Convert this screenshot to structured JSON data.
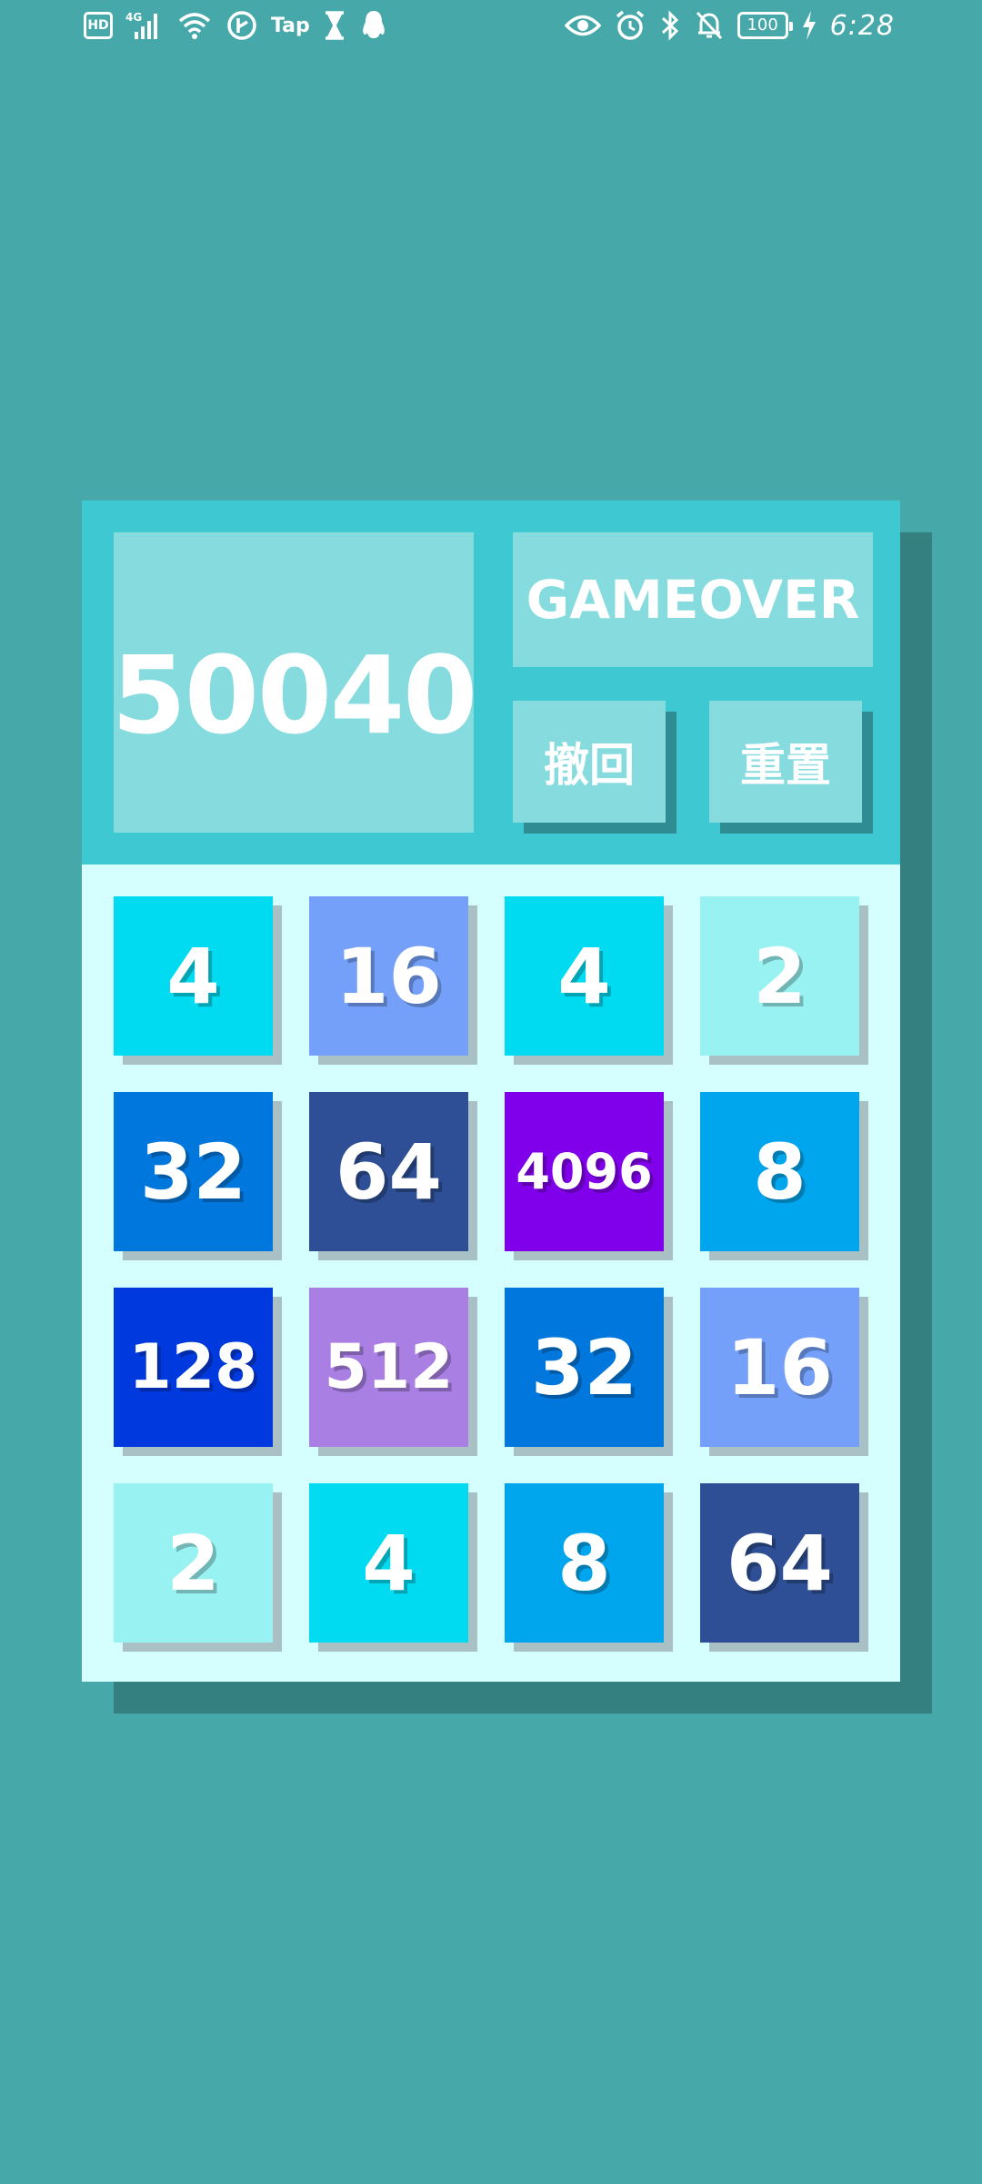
{
  "status_bar": {
    "hd": "HD",
    "network": "4G",
    "tap": "Tap",
    "battery": "100",
    "time": "6:28",
    "left_icons": [
      "hd-icon",
      "signal-4g-icon",
      "wifi-icon",
      "data-saver-icon",
      "tap-icon",
      "hourglass-icon",
      "qq-penguin-icon"
    ],
    "right_icons": [
      "eye-icon",
      "alarm-icon",
      "bluetooth-icon",
      "mute-bell-icon",
      "battery-icon",
      "charging-icon"
    ]
  },
  "game": {
    "score": "50040",
    "status": "GAMEOVER",
    "undo_label": "撤回",
    "reset_label": "重置",
    "board": [
      [
        "4",
        "16",
        "4",
        "2"
      ],
      [
        "32",
        "64",
        "4096",
        "8"
      ],
      [
        "128",
        "512",
        "32",
        "16"
      ],
      [
        "2",
        "4",
        "8",
        "64"
      ]
    ]
  },
  "colors": {
    "background": "#46a8a8",
    "header": "#3ec8d1",
    "panel": "#86dbdf",
    "board": "#d5ffff",
    "tiles": {
      "2": "#98f2f2",
      "4": "#00dbf2",
      "8": "#00a6ed",
      "16": "#74a0f9",
      "32": "#0077dd",
      "64": "#2e4f95",
      "128": "#0039de",
      "512": "#a97fe3",
      "4096": "#8000ec"
    }
  }
}
